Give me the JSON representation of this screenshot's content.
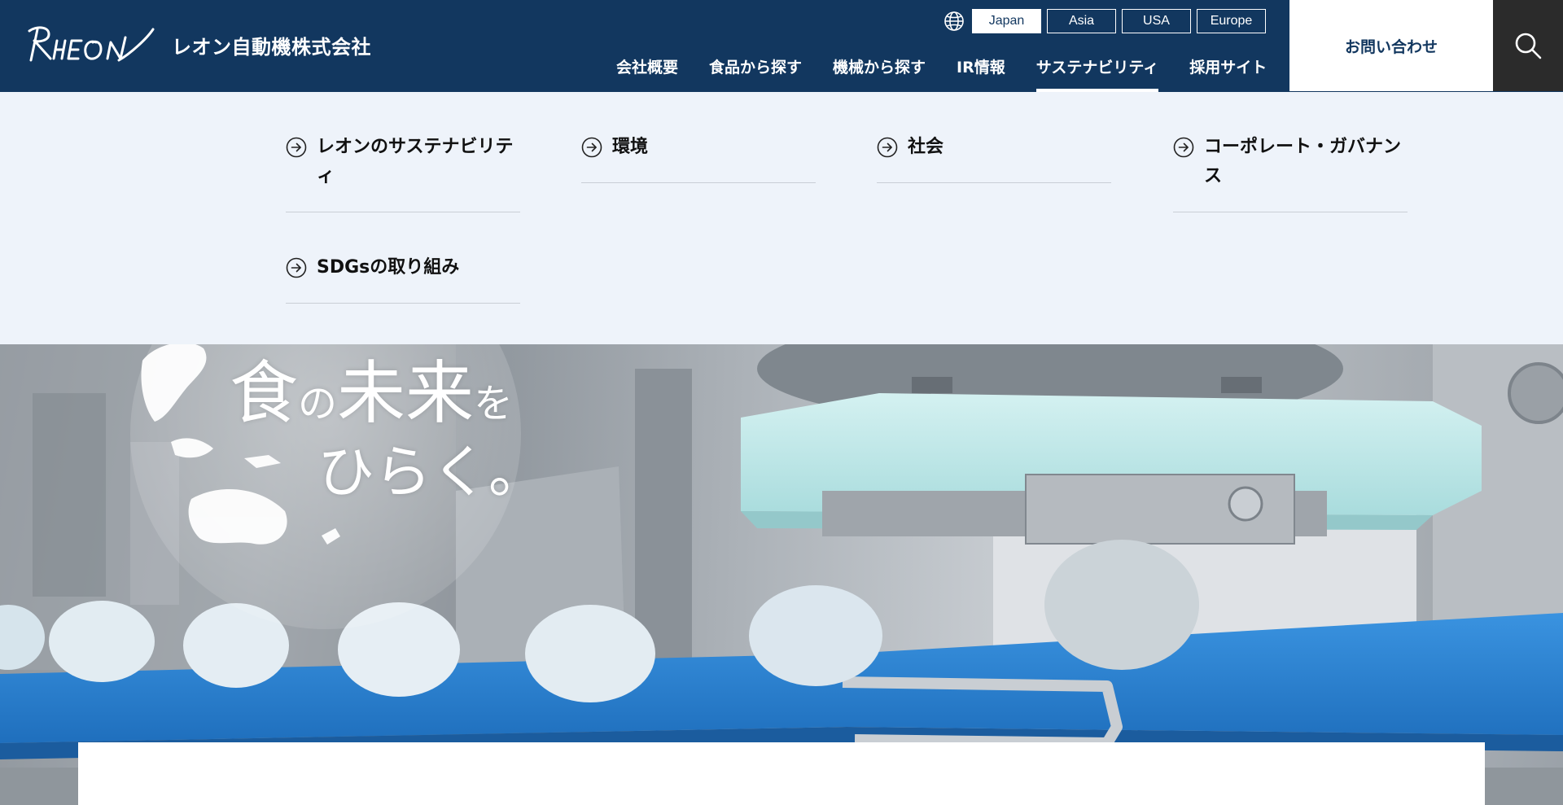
{
  "header": {
    "logo_alt": "RHEON",
    "company_name": "レオン自動機株式会社",
    "languages": [
      {
        "label": "Japan",
        "active": true
      },
      {
        "label": "Asia",
        "active": false
      },
      {
        "label": "USA",
        "active": false
      },
      {
        "label": "Europe",
        "active": false
      }
    ],
    "nav": [
      {
        "label": "会社概要",
        "active": false
      },
      {
        "label": "食品から探す",
        "active": false
      },
      {
        "label": "機械から探す",
        "active": false
      },
      {
        "label": "IR情報",
        "active": false
      },
      {
        "label": "サステナビリティ",
        "active": true
      },
      {
        "label": "採用サイト",
        "active": false
      }
    ],
    "contact_label": "お問い合わせ",
    "search_icon": "search-icon"
  },
  "mega_menu": {
    "items": [
      {
        "label": "レオンのサステナビリティ"
      },
      {
        "label": "環境"
      },
      {
        "label": "社会"
      },
      {
        "label": "コーポレート・ガバナンス"
      },
      {
        "label": "SDGsの取り組み"
      }
    ]
  },
  "hero": {
    "tagline_line1_a": "食",
    "tagline_line1_b": "の",
    "tagline_line1_c": "未来",
    "tagline_line1_d": "を",
    "tagline_line2": "ひらく。"
  },
  "colors": {
    "header_bg": "#12375f",
    "menu_bg": "#eef3fa",
    "search_bg": "#2b2b2b",
    "belt_blue": "#2f86d6"
  }
}
